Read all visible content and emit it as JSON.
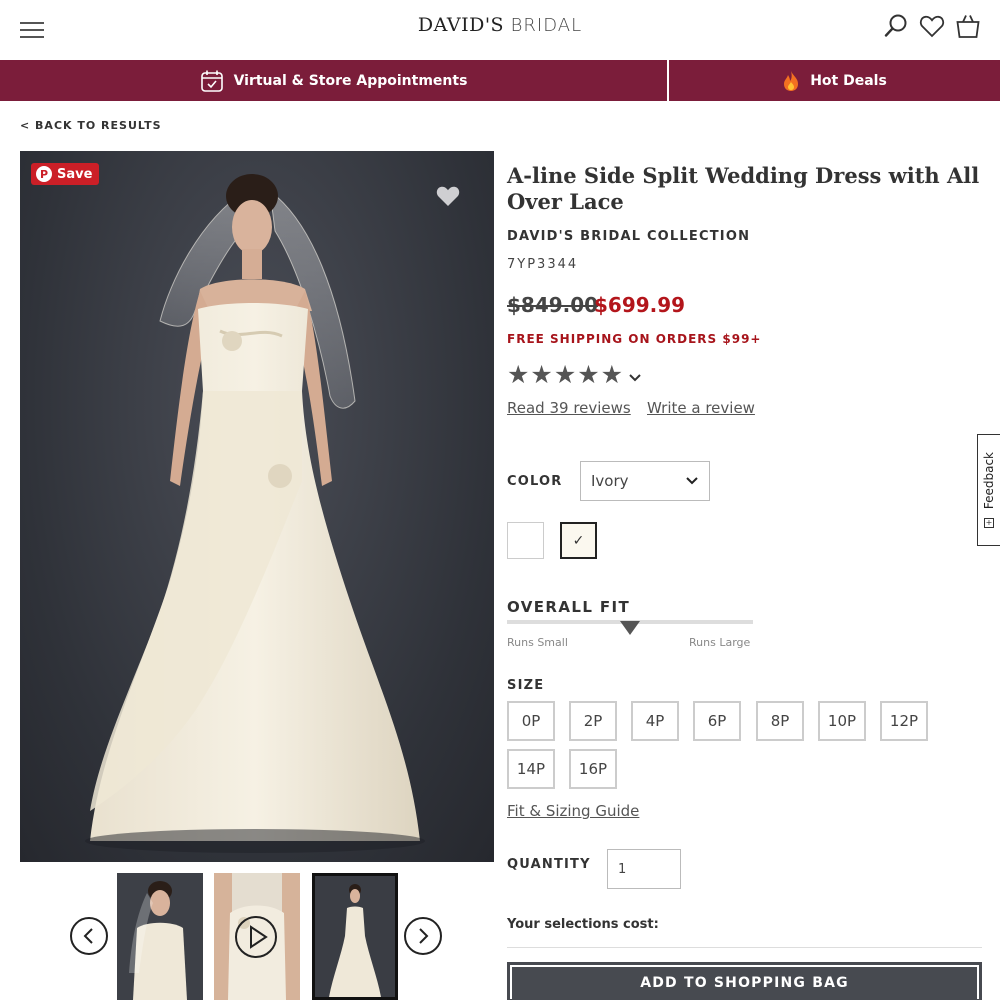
{
  "header": {
    "logo_main": "DAVID'S",
    "logo_sub": "BRIDAL"
  },
  "banner": {
    "appointments_label": "Virtual & Store Appointments",
    "deals_label": "Hot Deals"
  },
  "nav": {
    "back_label": "< BACK TO RESULTS"
  },
  "gallery": {
    "save_label": "Save",
    "pin_letter": "P"
  },
  "product": {
    "title": "A-line Side Split Wedding Dress with All Over Lace",
    "brand": "DAVID'S BRIDAL COLLECTION",
    "sku": "7YP3344",
    "price_original": "$849.00",
    "price_sale": "$699.99",
    "shipping_note": "FREE SHIPPING ON ORDERS $99+",
    "stars": "★★★★★",
    "rating": 5,
    "read_reviews_label": "Read 39 reviews",
    "write_review_label": "Write a review"
  },
  "color": {
    "label": "COLOR",
    "selected": "Ivory",
    "swatch_check": "✓"
  },
  "fit": {
    "title": "OVERALL FIT",
    "low_label": "Runs Small",
    "high_label": "Runs Large",
    "position_fraction": 0.5
  },
  "size": {
    "label": "SIZE",
    "options": [
      "0P",
      "2P",
      "4P",
      "6P",
      "8P",
      "10P",
      "12P",
      "14P",
      "16P"
    ],
    "guide_label": "Fit & Sizing Guide"
  },
  "quantity": {
    "label": "QUANTITY",
    "value": "1"
  },
  "cost_label": "Your selections cost:",
  "add_to_bag_label": "ADD TO SHOPPING BAG",
  "feedback_label": "Feedback",
  "feedback_icon_glyph": "+",
  "colors": {
    "banner": "#7b1d3a",
    "sale_price": "#b3151b",
    "pinterest": "#cb1f27"
  }
}
